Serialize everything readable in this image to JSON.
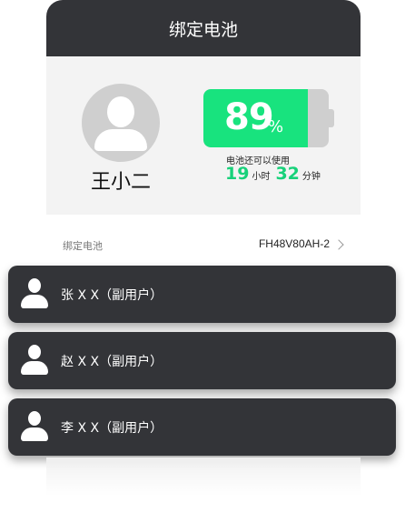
{
  "header": {
    "title": "绑定电池"
  },
  "profile": {
    "name": "王小二",
    "avatar_icon": "person-icon"
  },
  "battery": {
    "percent": "89",
    "percent_unit": "%",
    "level_fraction": 0.83,
    "remain_label": "电池还可以使用",
    "hours": "19",
    "hours_unit": "小时",
    "minutes": "32",
    "minutes_unit": "分钟",
    "fill_color": "#18e37e"
  },
  "bind": {
    "label": "绑定电池",
    "value": "FH48V80AH-2"
  },
  "subusers": [
    {
      "label": "张 X X（副用户）"
    },
    {
      "label": "赵 X X（副用户）"
    },
    {
      "label": "李 X X（副用户）"
    }
  ]
}
